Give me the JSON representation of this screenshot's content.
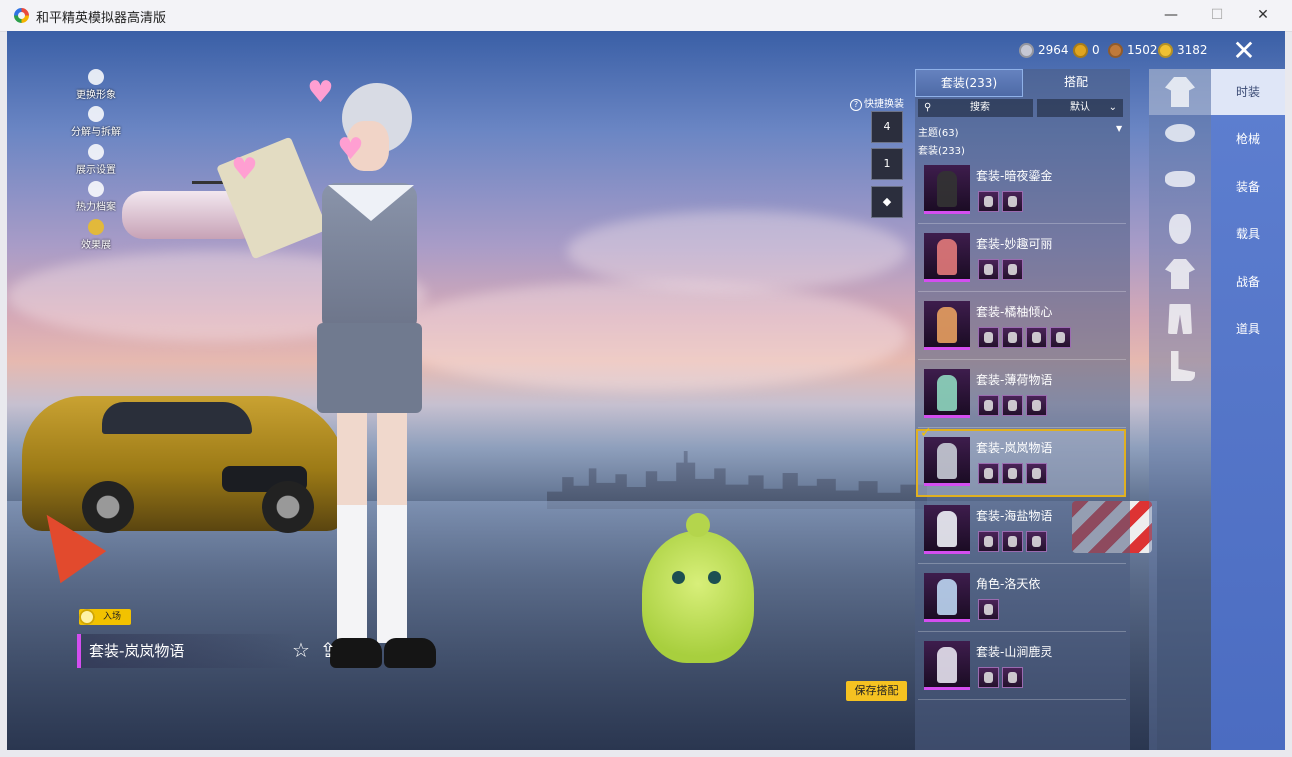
{
  "window": {
    "title": "和平精英模拟器高清版",
    "controls": [
      "—",
      "☐",
      "✕"
    ]
  },
  "currency": [
    {
      "icon": "silver-coin-icon",
      "value": "2964",
      "color": "#c6c8d4"
    },
    {
      "icon": "gold-token-icon",
      "value": "0",
      "color": "#e0a520"
    },
    {
      "icon": "bronze-token-icon",
      "value": "1502",
      "color": "#c07a3a"
    },
    {
      "icon": "gold-coin-icon",
      "value": "3182",
      "color": "#f0c132"
    }
  ],
  "left_menu": [
    {
      "label": "更换形象",
      "icon": "person-icon"
    },
    {
      "label": "分解与拆解",
      "icon": "puzzle-icon"
    },
    {
      "label": "展示设置",
      "icon": "eye-icon"
    },
    {
      "label": "热力档案",
      "icon": "flame-icon"
    },
    {
      "label": "效果展",
      "icon": "badge-icon"
    }
  ],
  "quick_change": {
    "label": "快捷换装",
    "slots": [
      {
        "value": "4",
        "icon": "outfit-slot-icon"
      },
      {
        "value": "1",
        "icon": "outfit-slot-icon"
      },
      {
        "value": "",
        "icon": "diamond-emblem-icon"
      }
    ]
  },
  "stage": {
    "entry_tag": "入场",
    "current_outfit": "套装-岚岚物语",
    "save_button": "保存搭配"
  },
  "panel": {
    "tabs": [
      "套装(233)",
      "搭配"
    ],
    "active_tab": 0,
    "search_placeholder": "搜索",
    "sort_value": "默认",
    "theme_label": "主题(63)",
    "sets_label": "套装(233)",
    "items": [
      {
        "name": "套装-暗夜鎏金",
        "parts": 2,
        "selected": false
      },
      {
        "name": "套装-妙趣可丽",
        "parts": 2,
        "selected": false
      },
      {
        "name": "套装-橘柚倾心",
        "parts": 4,
        "selected": false
      },
      {
        "name": "套装-薄荷物语",
        "parts": 3,
        "selected": false
      },
      {
        "name": "套装-岚岚物语",
        "parts": 3,
        "selected": true
      },
      {
        "name": "套装-海盐物语",
        "parts": 3,
        "selected": false
      },
      {
        "name": "角色-洛天依",
        "parts": 1,
        "selected": false
      },
      {
        "name": "套装-山涧鹿灵",
        "parts": 2,
        "selected": false
      }
    ]
  },
  "categories": {
    "labels": [
      "时装",
      "枪械",
      "装备",
      "载具",
      "战备",
      "道具"
    ],
    "active": 0,
    "slot_icons": [
      "outfit-icon",
      "accessory-icon",
      "glasses-icon",
      "mask-icon",
      "top-icon",
      "pants-icon",
      "shoes-icon"
    ]
  },
  "colors": {
    "accent_purple": "#d44ef0",
    "save_yellow": "#f5c221",
    "category_blue": "#4b6cc1"
  }
}
